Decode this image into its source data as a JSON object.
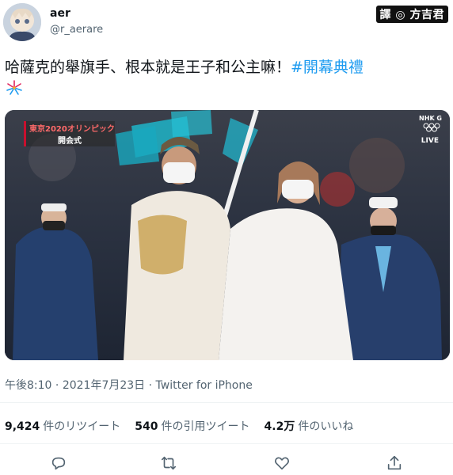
{
  "author": {
    "display_name": "aer",
    "handle": "@r_aerare"
  },
  "watermark": "譯 ◎ 方吉君",
  "tweet": {
    "text": "哈薩克的舉旗手、根本就是王子和公主嘛！",
    "hashtag": "#開幕典禮"
  },
  "media": {
    "overlay_line1": "東京2020オリンピック",
    "overlay_line2": "開会式",
    "network": "NHK G",
    "live_label": "LIVE"
  },
  "meta": {
    "time": "午後8:10",
    "date": "2021年7月23日",
    "source": "Twitter for iPhone",
    "separator": "·"
  },
  "stats": {
    "retweets_count": "9,424",
    "retweets_label": "件のリツイート",
    "quotes_count": "540",
    "quotes_label": "件の引用ツイート",
    "likes_count": "4.2万",
    "likes_label": "件のいいね"
  },
  "colors": {
    "link": "#1d9bf0",
    "secondary_text": "#536471",
    "divider": "#eff3f4"
  },
  "icons": {
    "reply": "reply-icon",
    "retweet": "retweet-icon",
    "like": "like-icon",
    "share": "share-icon"
  }
}
